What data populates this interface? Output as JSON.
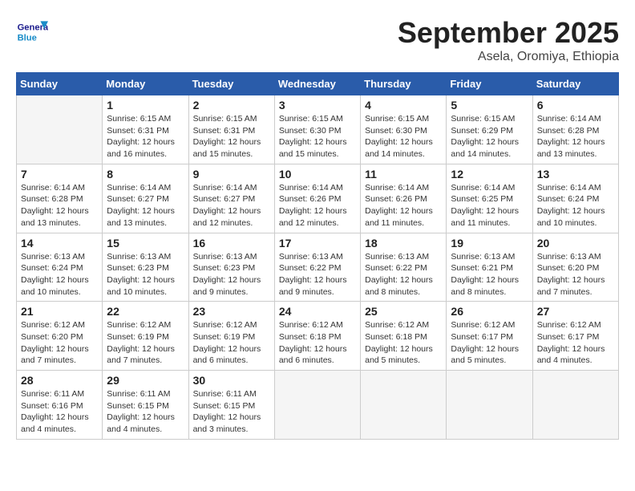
{
  "header": {
    "logo_general": "General",
    "logo_blue": "Blue",
    "month_year": "September 2025",
    "location": "Asela, Oromiya, Ethiopia"
  },
  "weekdays": [
    "Sunday",
    "Monday",
    "Tuesday",
    "Wednesday",
    "Thursday",
    "Friday",
    "Saturday"
  ],
  "weeks": [
    [
      {
        "day": "",
        "info": ""
      },
      {
        "day": "1",
        "info": "Sunrise: 6:15 AM\nSunset: 6:31 PM\nDaylight: 12 hours\nand 16 minutes."
      },
      {
        "day": "2",
        "info": "Sunrise: 6:15 AM\nSunset: 6:31 PM\nDaylight: 12 hours\nand 15 minutes."
      },
      {
        "day": "3",
        "info": "Sunrise: 6:15 AM\nSunset: 6:30 PM\nDaylight: 12 hours\nand 15 minutes."
      },
      {
        "day": "4",
        "info": "Sunrise: 6:15 AM\nSunset: 6:30 PM\nDaylight: 12 hours\nand 14 minutes."
      },
      {
        "day": "5",
        "info": "Sunrise: 6:15 AM\nSunset: 6:29 PM\nDaylight: 12 hours\nand 14 minutes."
      },
      {
        "day": "6",
        "info": "Sunrise: 6:14 AM\nSunset: 6:28 PM\nDaylight: 12 hours\nand 13 minutes."
      }
    ],
    [
      {
        "day": "7",
        "info": "Sunrise: 6:14 AM\nSunset: 6:28 PM\nDaylight: 12 hours\nand 13 minutes."
      },
      {
        "day": "8",
        "info": "Sunrise: 6:14 AM\nSunset: 6:27 PM\nDaylight: 12 hours\nand 13 minutes."
      },
      {
        "day": "9",
        "info": "Sunrise: 6:14 AM\nSunset: 6:27 PM\nDaylight: 12 hours\nand 12 minutes."
      },
      {
        "day": "10",
        "info": "Sunrise: 6:14 AM\nSunset: 6:26 PM\nDaylight: 12 hours\nand 12 minutes."
      },
      {
        "day": "11",
        "info": "Sunrise: 6:14 AM\nSunset: 6:26 PM\nDaylight: 12 hours\nand 11 minutes."
      },
      {
        "day": "12",
        "info": "Sunrise: 6:14 AM\nSunset: 6:25 PM\nDaylight: 12 hours\nand 11 minutes."
      },
      {
        "day": "13",
        "info": "Sunrise: 6:14 AM\nSunset: 6:24 PM\nDaylight: 12 hours\nand 10 minutes."
      }
    ],
    [
      {
        "day": "14",
        "info": "Sunrise: 6:13 AM\nSunset: 6:24 PM\nDaylight: 12 hours\nand 10 minutes."
      },
      {
        "day": "15",
        "info": "Sunrise: 6:13 AM\nSunset: 6:23 PM\nDaylight: 12 hours\nand 10 minutes."
      },
      {
        "day": "16",
        "info": "Sunrise: 6:13 AM\nSunset: 6:23 PM\nDaylight: 12 hours\nand 9 minutes."
      },
      {
        "day": "17",
        "info": "Sunrise: 6:13 AM\nSunset: 6:22 PM\nDaylight: 12 hours\nand 9 minutes."
      },
      {
        "day": "18",
        "info": "Sunrise: 6:13 AM\nSunset: 6:22 PM\nDaylight: 12 hours\nand 8 minutes."
      },
      {
        "day": "19",
        "info": "Sunrise: 6:13 AM\nSunset: 6:21 PM\nDaylight: 12 hours\nand 8 minutes."
      },
      {
        "day": "20",
        "info": "Sunrise: 6:13 AM\nSunset: 6:20 PM\nDaylight: 12 hours\nand 7 minutes."
      }
    ],
    [
      {
        "day": "21",
        "info": "Sunrise: 6:12 AM\nSunset: 6:20 PM\nDaylight: 12 hours\nand 7 minutes."
      },
      {
        "day": "22",
        "info": "Sunrise: 6:12 AM\nSunset: 6:19 PM\nDaylight: 12 hours\nand 7 minutes."
      },
      {
        "day": "23",
        "info": "Sunrise: 6:12 AM\nSunset: 6:19 PM\nDaylight: 12 hours\nand 6 minutes."
      },
      {
        "day": "24",
        "info": "Sunrise: 6:12 AM\nSunset: 6:18 PM\nDaylight: 12 hours\nand 6 minutes."
      },
      {
        "day": "25",
        "info": "Sunrise: 6:12 AM\nSunset: 6:18 PM\nDaylight: 12 hours\nand 5 minutes."
      },
      {
        "day": "26",
        "info": "Sunrise: 6:12 AM\nSunset: 6:17 PM\nDaylight: 12 hours\nand 5 minutes."
      },
      {
        "day": "27",
        "info": "Sunrise: 6:12 AM\nSunset: 6:17 PM\nDaylight: 12 hours\nand 4 minutes."
      }
    ],
    [
      {
        "day": "28",
        "info": "Sunrise: 6:11 AM\nSunset: 6:16 PM\nDaylight: 12 hours\nand 4 minutes."
      },
      {
        "day": "29",
        "info": "Sunrise: 6:11 AM\nSunset: 6:15 PM\nDaylight: 12 hours\nand 4 minutes."
      },
      {
        "day": "30",
        "info": "Sunrise: 6:11 AM\nSunset: 6:15 PM\nDaylight: 12 hours\nand 3 minutes."
      },
      {
        "day": "",
        "info": ""
      },
      {
        "day": "",
        "info": ""
      },
      {
        "day": "",
        "info": ""
      },
      {
        "day": "",
        "info": ""
      }
    ]
  ]
}
